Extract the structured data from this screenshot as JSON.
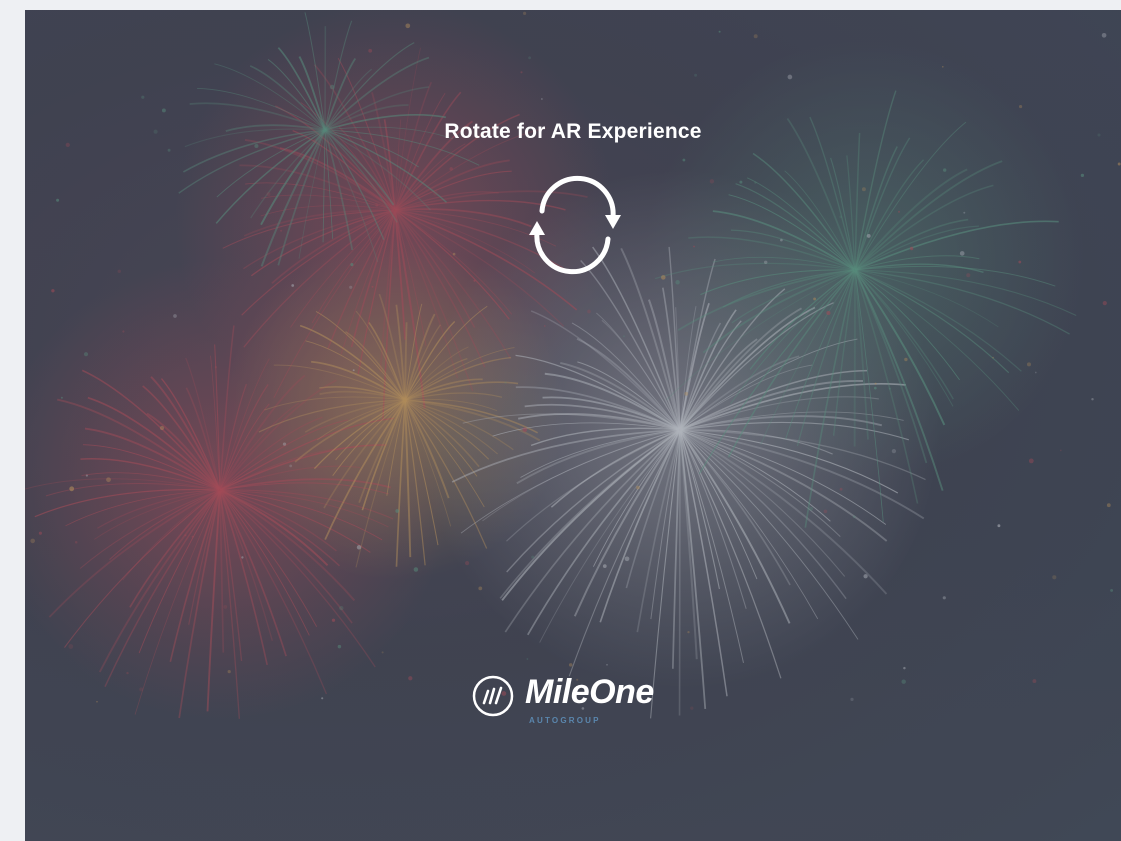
{
  "prompt": {
    "title": "Rotate for AR Experience",
    "icon": "rotate-arrows-icon"
  },
  "brand": {
    "name": "MileOne",
    "subtitle": "AUTOGROUP",
    "badge_icon": "mileone-logo-icon",
    "subtitle_color": "#5a86ad"
  },
  "background": {
    "image": "fireworks-background",
    "colors": [
      "#c24a55",
      "#d7a35a",
      "#5fa588",
      "#d5d8dc"
    ]
  }
}
